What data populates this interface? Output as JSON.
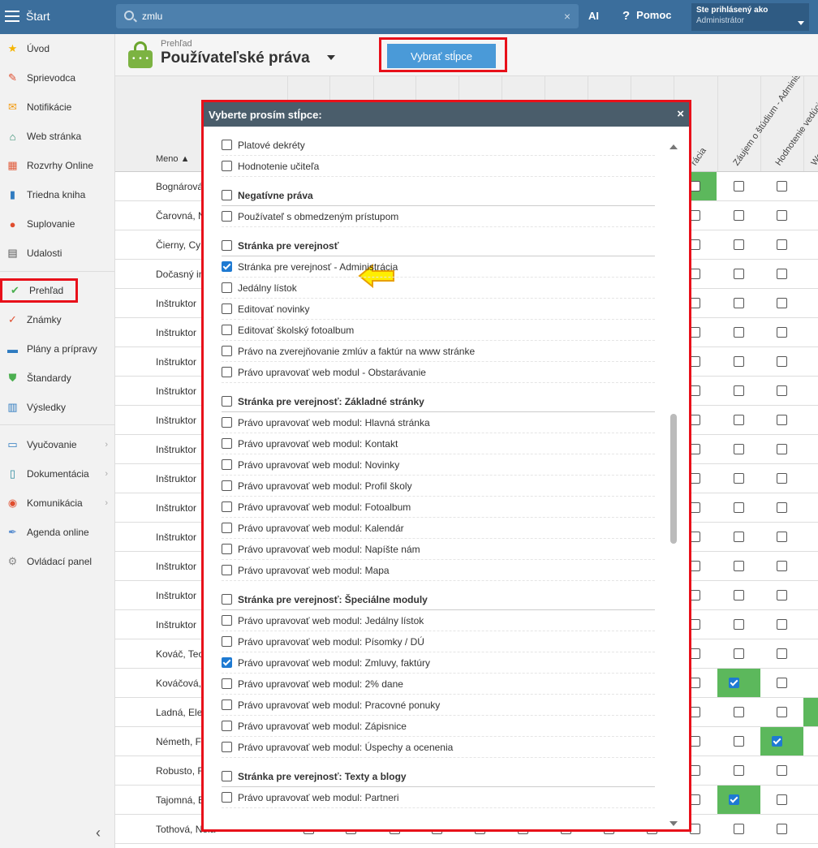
{
  "topbar": {
    "start_label": "Štart",
    "search_value": "zmlu",
    "clear_icon": "×",
    "ai_label": "AI",
    "help_icon": "?",
    "help_label": "Pomoc",
    "user_line1": "Ste prihlásený ako",
    "user_line2": "Administrátor"
  },
  "sidebar": {
    "items": [
      {
        "label": "Úvod",
        "icon": "star-icon",
        "glyph": "★",
        "color": "#f5b400"
      },
      {
        "label": "Sprievodca",
        "icon": "wand-icon",
        "glyph": "✎",
        "color": "#e04e2f"
      },
      {
        "label": "Notifikácie",
        "icon": "envelope-icon",
        "glyph": "✉",
        "color": "#f39c12"
      },
      {
        "label": "Web stránka",
        "icon": "home-icon",
        "glyph": "⌂",
        "color": "#2e8b6e"
      },
      {
        "label": "Rozvrhy Online",
        "icon": "grid-icon",
        "glyph": "▦",
        "color": "#e05a3a"
      },
      {
        "label": "Triedna kniha",
        "icon": "book-icon",
        "glyph": "▮",
        "color": "#2f7bc0"
      },
      {
        "label": "Suplovanie",
        "icon": "person-icon",
        "glyph": "●",
        "color": "#e04e2f"
      },
      {
        "label": "Udalosti",
        "icon": "calendar-icon",
        "glyph": "▤",
        "color": "#555"
      },
      {
        "label": "Prehľad",
        "icon": "check-circle-icon",
        "glyph": "✔",
        "color": "#4caf50"
      },
      {
        "label": "Známky",
        "icon": "grade-icon",
        "glyph": "✓",
        "color": "#e04e2f"
      },
      {
        "label": "Plány a prípravy",
        "icon": "briefcase-icon",
        "glyph": "▬",
        "color": "#2f7bc0"
      },
      {
        "label": "Štandardy",
        "icon": "shield-icon",
        "glyph": "⛊",
        "color": "#4caf50"
      },
      {
        "label": "Výsledky",
        "icon": "bar-chart-icon",
        "glyph": "▥",
        "color": "#2f7bc0"
      },
      {
        "label": "Vyučovanie",
        "icon": "open-book-icon",
        "glyph": "▭",
        "color": "#2f7bc0"
      },
      {
        "label": "Dokumentácia",
        "icon": "document-icon",
        "glyph": "▯",
        "color": "#2e8b9e"
      },
      {
        "label": "Komunikácia",
        "icon": "chat-icon",
        "glyph": "◉",
        "color": "#e04e2f"
      },
      {
        "label": "Agenda online",
        "icon": "pen-icon",
        "glyph": "✒",
        "color": "#5b8fd0"
      },
      {
        "label": "Ovládací panel",
        "icon": "gear-icon",
        "glyph": "⚙",
        "color": "#888"
      }
    ],
    "chevron": "›",
    "collapse": "‹"
  },
  "header": {
    "breadcrumb": "Prehľad",
    "title": "Používateľské práva",
    "pick_columns": "Vybrať stĺpce"
  },
  "table": {
    "name_header": "Meno ▲",
    "rotated_headers": [
      "rácia",
      "Záujem o štúdium - Administrácia",
      "Hodnotenie vedúcich zamestnancov - Výsle",
      "Wellbeing - Výsled"
    ],
    "rows": [
      "Bognárová,",
      "Čarovná, N",
      "Čierny, Cy",
      "Dočasný in",
      "Inštruktor ",
      "Inštruktor ",
      "Inštruktor ",
      "Inštruktor ",
      "Inštruktor ",
      "Inštruktor ",
      "Inštruktor ",
      "Inštruktor ",
      "Inštruktor ",
      "Inštruktor ",
      "Inštruktor ",
      "Inštruktor ",
      "Kováč, Teo",
      "Kováčová,",
      "Ladná, Ele",
      "Németh, F",
      "Robusto, R",
      "Tajomná, E",
      "Tothová, Nela"
    ]
  },
  "dialog": {
    "title": "Vyberte prosím stĺpce:",
    "close": "×",
    "options": [
      {
        "label": "Platové dekréty",
        "checked": false,
        "group": false
      },
      {
        "label": "Hodnotenie učiteľa",
        "checked": false,
        "group": false
      },
      {
        "label": "Negatívne práva",
        "checked": false,
        "group": true
      },
      {
        "label": "Používateľ s obmedzeným prístupom",
        "checked": false,
        "group": false
      },
      {
        "label": "Stránka pre verejnosť",
        "checked": false,
        "group": true
      },
      {
        "label": "Stránka pre verejnosť - Administrácia",
        "checked": true,
        "group": false
      },
      {
        "label": "Jedálny lístok",
        "checked": false,
        "group": false
      },
      {
        "label": "Editovať novinky",
        "checked": false,
        "group": false
      },
      {
        "label": "Editovať školský fotoalbum",
        "checked": false,
        "group": false
      },
      {
        "label": "Právo na zverejňovanie zmlúv a faktúr na www stránke",
        "checked": false,
        "group": false
      },
      {
        "label": "Právo upravovať web modul - Obstarávanie",
        "checked": false,
        "group": false
      },
      {
        "label": "Stránka pre verejnosť: Základné stránky",
        "checked": false,
        "group": true
      },
      {
        "label": "Právo upravovať web modul: Hlavná stránka",
        "checked": false,
        "group": false
      },
      {
        "label": "Právo upravovať web modul: Kontakt",
        "checked": false,
        "group": false
      },
      {
        "label": "Právo upravovať web modul: Novinky",
        "checked": false,
        "group": false
      },
      {
        "label": "Právo upravovať web modul: Profil školy",
        "checked": false,
        "group": false
      },
      {
        "label": "Právo upravovať web modul: Fotoalbum",
        "checked": false,
        "group": false
      },
      {
        "label": "Právo upravovať web modul: Kalendár",
        "checked": false,
        "group": false
      },
      {
        "label": "Právo upravovať web modul: Napíšte nám",
        "checked": false,
        "group": false
      },
      {
        "label": "Právo upravovať web modul: Mapa",
        "checked": false,
        "group": false
      },
      {
        "label": "Stránka pre verejnosť: Špeciálne moduly",
        "checked": false,
        "group": true
      },
      {
        "label": "Právo upravovať web modul: Jedálny lístok",
        "checked": false,
        "group": false
      },
      {
        "label": "Právo upravovať web modul: Písomky / DÚ",
        "checked": false,
        "group": false
      },
      {
        "label": "Právo upravovať web modul: Zmluvy, faktúry",
        "checked": true,
        "group": false
      },
      {
        "label": "Právo upravovať web modul: 2% dane",
        "checked": false,
        "group": false
      },
      {
        "label": "Právo upravovať web modul: Pracovné ponuky",
        "checked": false,
        "group": false
      },
      {
        "label": "Právo upravovať web modul: Zápisnice",
        "checked": false,
        "group": false
      },
      {
        "label": "Právo upravovať web modul: Úspechy a ocenenia",
        "checked": false,
        "group": false
      },
      {
        "label": "Stránka pre verejnosť: Texty a blogy",
        "checked": false,
        "group": true
      },
      {
        "label": "Právo upravovať web modul: Partneri",
        "checked": false,
        "group": false
      }
    ]
  },
  "colors": {
    "accent": "#3b6e9c",
    "highlight": "#e8101a",
    "check": "#1e7ad2",
    "green": "#5cb85c"
  }
}
